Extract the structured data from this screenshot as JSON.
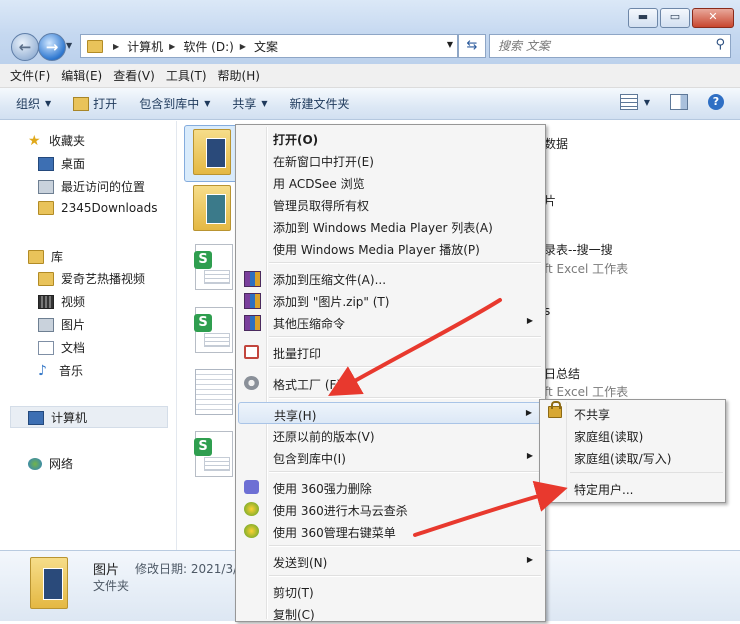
{
  "address": {
    "crumbs": [
      "计算机",
      "软件 (D:)",
      "文案"
    ]
  },
  "search": {
    "placeholder": "搜索 文案"
  },
  "menubar": [
    "文件(F)",
    "编辑(E)",
    "查看(V)",
    "工具(T)",
    "帮助(H)"
  ],
  "toolbar": {
    "organize": "组织",
    "open": "打开",
    "include": "包含到库中",
    "share": "共享",
    "new_folder": "新建文件夹"
  },
  "nav": {
    "favorites": "收藏夹",
    "fav_items": [
      "桌面",
      "最近访问的位置",
      "2345Downloads"
    ],
    "libraries": "库",
    "lib_items": [
      "爱奇艺热播视频",
      "视频",
      "图片",
      "文档",
      "音乐"
    ],
    "computer": "计算机",
    "network": "网络"
  },
  "files_partial": [
    "数据",
    "片",
    "录表--搜一搜",
    "ft Excel 工作表",
    "s",
    "日总结",
    "ft Excel 工作表"
  ],
  "details": {
    "name": "图片",
    "modified": "修改日期: 2021/3/",
    "type": "文件夹"
  },
  "context_menu": {
    "open": "打开(O)",
    "open_new_window": "在新窗口中打开(E)",
    "acdsee": "用 ACDSee 浏览",
    "take_ownership": "管理员取得所有权",
    "wmp_add": "添加到 Windows Media Player 列表(A)",
    "wmp_play": "使用 Windows Media Player 播放(P)",
    "add_archive": "添加到压缩文件(A)...",
    "add_zip": "添加到 \"图片.zip\" (T)",
    "other_compress": "其他压缩命令",
    "batch_print": "批量打印",
    "format_factory": "格式工厂 (F)",
    "share": "共享(H)",
    "restore": "还原以前的版本(V)",
    "include_library": "包含到库中(I)",
    "delete_360": "使用 360强力删除",
    "scan_360": "使用 360进行木马云查杀",
    "manage_360": "使用 360管理右键菜单",
    "send_to": "发送到(N)",
    "cut": "剪切(T)",
    "copy": "复制(C)"
  },
  "share_submenu": {
    "no_share": "不共享",
    "homegroup_read": "家庭组(读取)",
    "homegroup_rw": "家庭组(读取/写入)",
    "specific_users": "特定用户..."
  },
  "colors": {
    "annotation_arrow": "#e8392e",
    "highlight": "#dce8f6",
    "accent": "#2f78d0"
  }
}
